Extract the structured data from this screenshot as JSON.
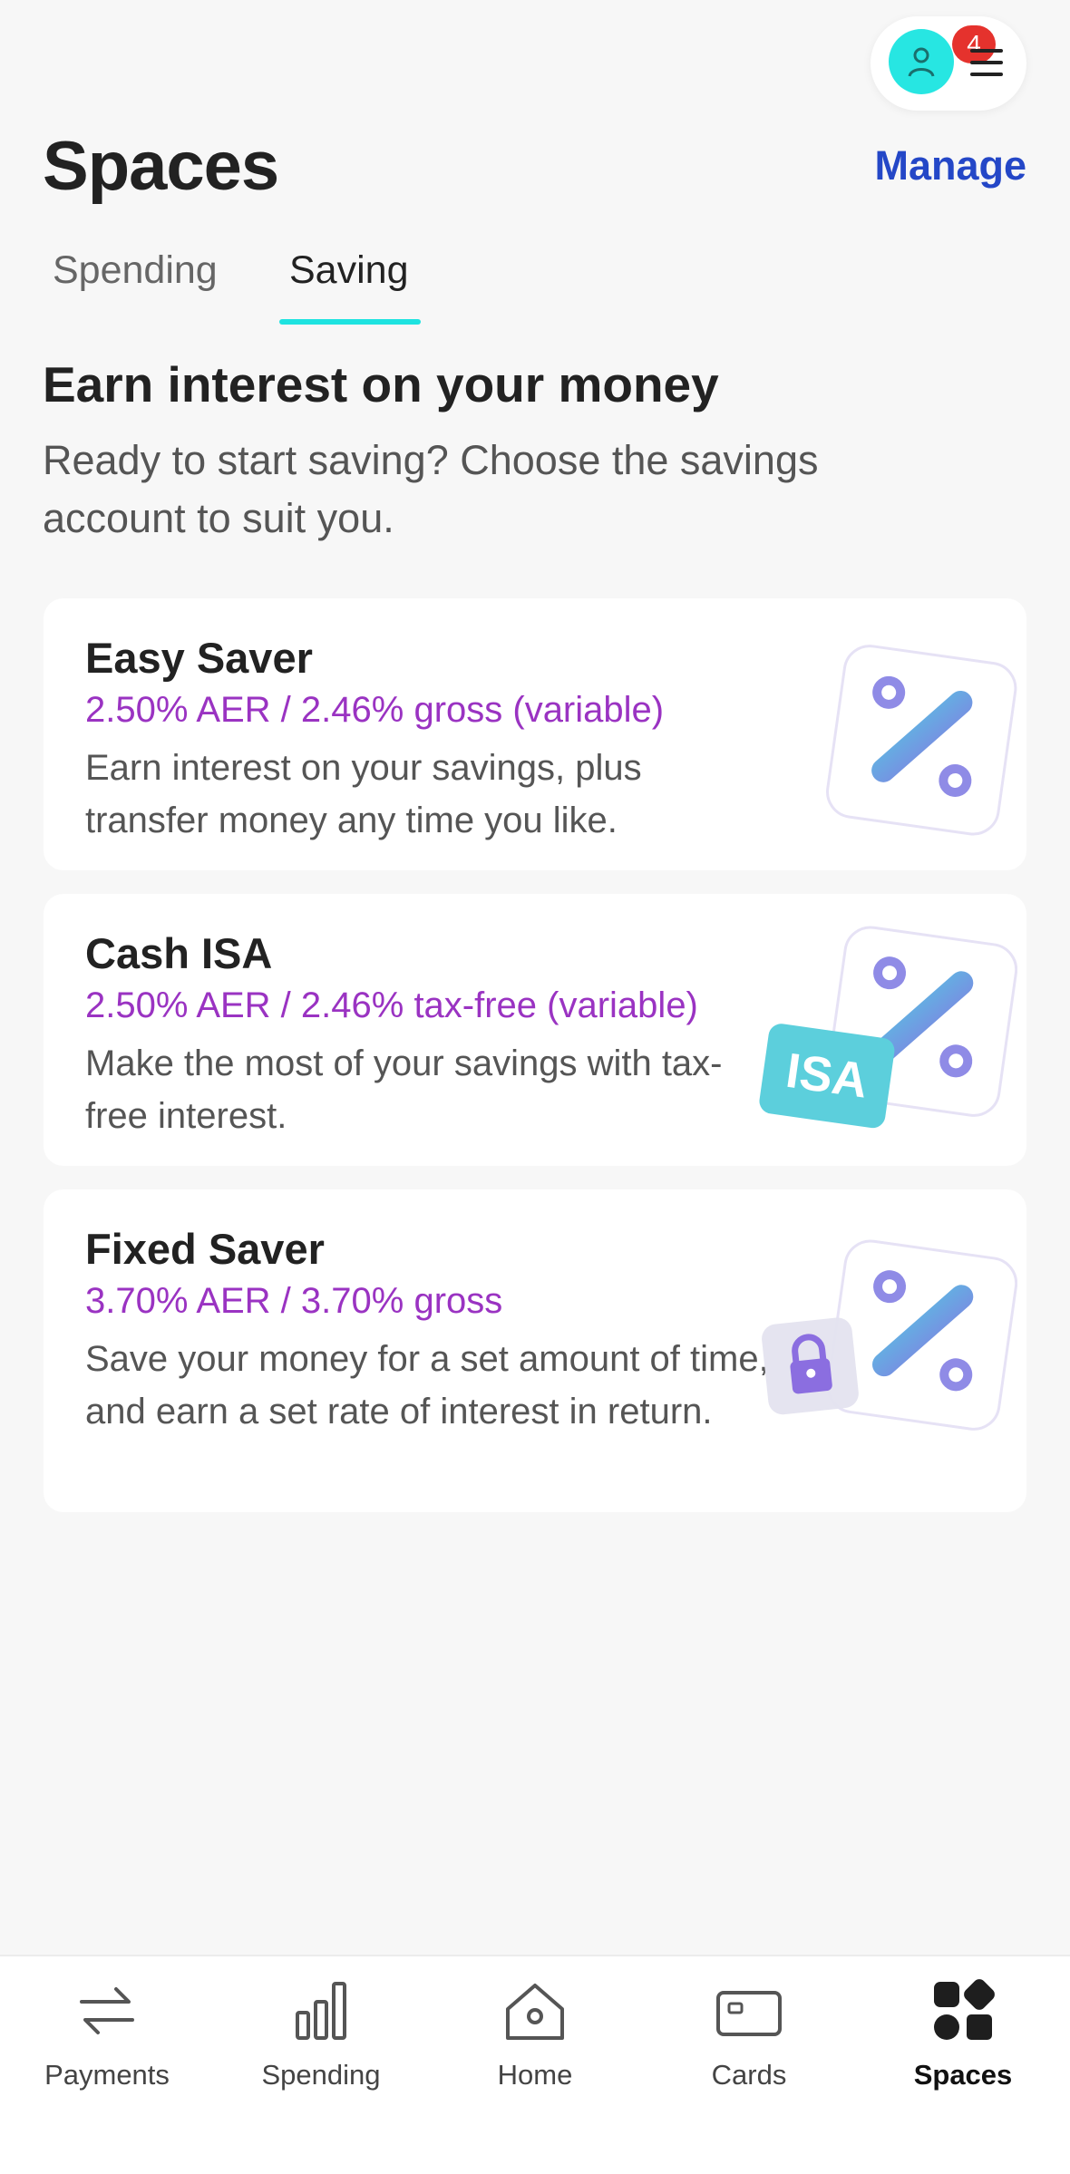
{
  "header": {
    "notification_count": "4",
    "title": "Spaces",
    "manage_label": "Manage"
  },
  "tabs": [
    {
      "label": "Spending",
      "active": false
    },
    {
      "label": "Saving",
      "active": true
    }
  ],
  "section": {
    "heading": "Earn interest on your money",
    "subheading": "Ready to start saving? Choose the savings account to suit you."
  },
  "accounts": [
    {
      "title": "Easy Saver",
      "rate": "2.50% AER / 2.46% gross (variable)",
      "description": "Earn interest on your savings, plus transfer money any time you like.",
      "icon": "percent-tile-icon"
    },
    {
      "title": "Cash ISA",
      "rate": "2.50% AER / 2.46% tax-free (variable)",
      "description": "Make the most of your savings with tax-free interest.",
      "icon": "isa-percent-tile-icon",
      "tag": "ISA"
    },
    {
      "title": "Fixed Saver",
      "rate": "3.70% AER / 3.70% gross",
      "description": "Save your money for a set amount of time, and earn a set rate of interest in return.",
      "icon": "lock-percent-tile-icon"
    }
  ],
  "bottom_nav": [
    {
      "label": "Payments",
      "icon": "arrows-exchange-icon",
      "active": false
    },
    {
      "label": "Spending",
      "icon": "bar-chart-icon",
      "active": false
    },
    {
      "label": "Home",
      "icon": "home-icon",
      "active": false
    },
    {
      "label": "Cards",
      "icon": "card-icon",
      "active": false
    },
    {
      "label": "Spaces",
      "icon": "spaces-grid-icon",
      "active": true
    }
  ],
  "colors": {
    "accent_teal": "#1ee3e0",
    "link_blue": "#2447c7",
    "rate_purple": "#9a33c2",
    "badge_red": "#e5322d"
  }
}
